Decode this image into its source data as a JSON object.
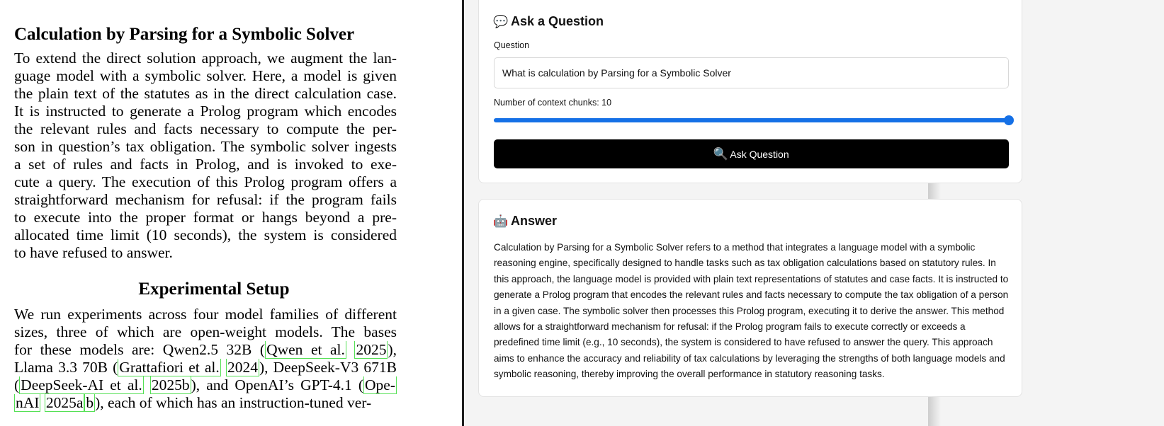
{
  "document": {
    "heading1": "Calculation by Parsing for a Symbolic Solver",
    "para1_lines": [
      "To extend the direct solution approach, we augment the lan-",
      "guage model with a symbolic solver. Here, a model is given",
      "the plain text of the statutes as in the direct calculation case.",
      "It is instructed to generate a Prolog program which encodes",
      "the relevant rules and facts necessary to compute the per-",
      "son in question’s tax obligation. The symbolic solver ingests",
      "a set of rules and facts in Prolog, and is invoked to exe-",
      "cute a query. The execution of this Prolog program offers a",
      "straightforward mechanism for refusal: if the program fails",
      "to execute into the proper format or hangs beyond a pre-",
      "allocated time limit (10 seconds), the system is considered",
      "to have refused to answer."
    ],
    "heading2": "Experimental Setup",
    "para2": {
      "l1": "We run experiments across four model families of different",
      "l2": "sizes, three of which are open-weight models. The bases",
      "l3_pre": "for these models are: Qwen2.5 32B (",
      "l3_cite_a": "Qwen et al.",
      "l3_cite_b": "2025",
      "l3_post": "),",
      "l4_pre": "Llama 3.3 70B (",
      "l4_cite_a": "Grattafiori et al.",
      "l4_cite_b": "2024",
      "l4_post": "), DeepSeek-V3 671B",
      "l5_pre": "(",
      "l5_cite_a": "DeepSeek-AI et al.",
      "l5_cite_b": "2025b",
      "l5_mid": "), and OpenAI’s GPT-4.1 (",
      "l5_cite_c": "Ope-",
      "l6_cite_a": "nAI",
      "l6_cite_b": "2025a",
      "l6_cite_c": "b",
      "l6_post": "), each of which has an instruction-tuned ver-"
    }
  },
  "ask_card": {
    "emoji": "💬",
    "title": "Ask a Question",
    "question_label": "Question",
    "question_value": "What is calculation by Parsing for a Symbolic Solver",
    "chunks_label": "Number of context chunks: 10",
    "chunks_value": 10,
    "chunks_fill_fraction": 1.0,
    "button_emoji": "🔍",
    "button_label": "Ask Question"
  },
  "answer_card": {
    "emoji": "🤖",
    "title": "Answer",
    "text": "Calculation by Parsing for a Symbolic Solver refers to a method that integrates a language model with a symbolic reasoning engine, specifically designed to handle tasks such as tax obligation calculations based on statutory rules. In this approach, the language model is provided with plain text representations of statutes and case facts. It is instructed to generate a Prolog program that encodes the relevant rules and facts necessary to compute the tax obligation of a person in a given case. The symbolic solver then processes this Prolog program, executing it to derive the answer. This method allows for a straightforward mechanism for refusal: if the Prolog program fails to execute correctly or exceeds a predefined time limit (e.g., 10 seconds), the system is considered to have refused to answer the query. This approach aims to enhance the accuracy and reliability of tax calculations by leveraging the strengths of both language models and symbolic reasoning, thereby improving the overall performance in statutory reasoning tasks."
  },
  "colors": {
    "accent": "#1570e6",
    "button_bg": "#000000",
    "citation_border": "#55e055"
  }
}
